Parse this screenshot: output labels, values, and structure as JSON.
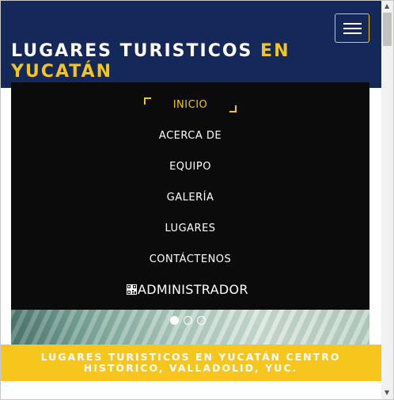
{
  "header": {
    "title_main": "LUGARES TURISTICOS ",
    "title_accent": "EN YUCATÁN",
    "menu_toggle_icon": "hamburger-icon"
  },
  "menu": {
    "items": [
      {
        "label": "INICIO",
        "active": true
      },
      {
        "label": "ACERCA DE",
        "active": false
      },
      {
        "label": "EQUIPO",
        "active": false
      },
      {
        "label": "GALERÍA",
        "active": false
      },
      {
        "label": "LUGARES",
        "active": false
      },
      {
        "label": "CONTÁCTENOS",
        "active": false
      }
    ],
    "admin_label": "ADMINISTRADOR",
    "admin_icon": "qr-code-icon"
  },
  "carousel": {
    "slide_count": 3,
    "active_slide": 1
  },
  "banner": {
    "text": "LUGARES TURISTICOS EN YUCATÁN CENTRO HISTÓRICO, VALLADOLID, YUC."
  },
  "colors": {
    "header_bg": "#14285a",
    "accent": "#f5c518",
    "menu_bg": "#0b0b0b",
    "banner_bg": "#f7c61c"
  }
}
